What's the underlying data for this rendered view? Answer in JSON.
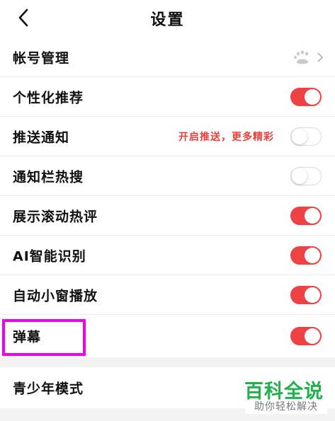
{
  "header": {
    "title": "设置"
  },
  "settings": [
    {
      "label": "帐号管理"
    },
    {
      "label": "个性化推荐",
      "on": true
    },
    {
      "label": "推送通知",
      "promo": "开启推送，更多精彩",
      "on": false
    },
    {
      "label": "通知栏热搜",
      "on": false
    },
    {
      "label": "展示滚动热评",
      "on": true
    },
    {
      "label": "AI智能识别",
      "on": true
    },
    {
      "label": "自动小窗播放",
      "on": true
    },
    {
      "label": "弹幕",
      "on": true
    },
    {
      "label": "青少年模式"
    }
  ],
  "watermark": {
    "title": "百科全说",
    "subtitle": "助你轻松解决"
  },
  "colors": {
    "toggle_on": "#ef4245",
    "promo": "#e8403a",
    "highlight": "#ee00ee",
    "watermark": "#21b04b"
  },
  "icons": {
    "back": "chevron-left-icon",
    "account": "paw-icon",
    "account_arrow": "chevron-right-icon"
  }
}
